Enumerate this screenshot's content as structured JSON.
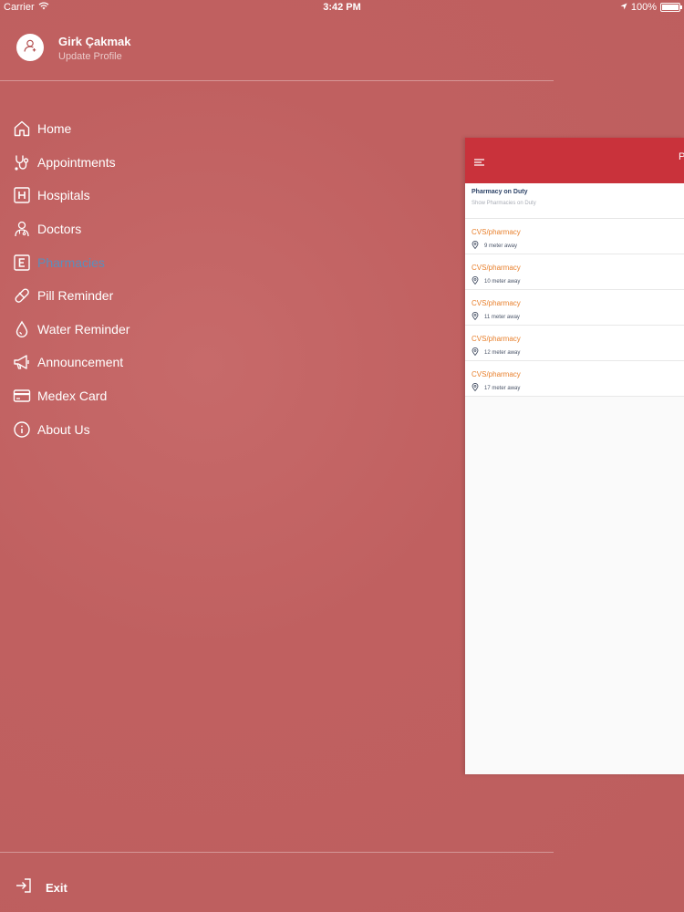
{
  "status_bar": {
    "carrier": "Carrier",
    "time": "3:42 PM",
    "battery": "100%"
  },
  "profile": {
    "name": "Girk  Çakmak",
    "subtitle": "Update Profile"
  },
  "menu": {
    "items": [
      {
        "label": "Home",
        "icon": "home-icon"
      },
      {
        "label": "Appointments",
        "icon": "stethoscope-icon"
      },
      {
        "label": "Hospitals",
        "icon": "hospital-icon"
      },
      {
        "label": "Doctors",
        "icon": "doctor-icon"
      },
      {
        "label": "Pharmacies",
        "icon": "pharmacy-icon",
        "active": true
      },
      {
        "label": "Pill Reminder",
        "icon": "pill-icon"
      },
      {
        "label": "Water Reminder",
        "icon": "water-drop-icon"
      },
      {
        "label": "Announcement",
        "icon": "megaphone-icon"
      },
      {
        "label": "Medex Card",
        "icon": "card-icon"
      },
      {
        "label": "About Us",
        "icon": "info-icon"
      }
    ]
  },
  "exit": {
    "label": "Exit"
  },
  "panel": {
    "title_partial": "P",
    "subheader": {
      "title": "Pharmacy on Duty",
      "subtitle": "Show Pharmacies on Duty"
    },
    "pharmacies": [
      {
        "name": "CVS/pharmacy",
        "distance": "9 meter away"
      },
      {
        "name": "CVS/pharmacy",
        "distance": "10 meter away"
      },
      {
        "name": "CVS/pharmacy",
        "distance": "11 meter away"
      },
      {
        "name": "CVS/pharmacy",
        "distance": "12 meter away"
      },
      {
        "name": "CVS/pharmacy",
        "distance": "17 meter away"
      }
    ]
  },
  "colors": {
    "background": "#c26262",
    "header_red": "#c9323b",
    "accent_orange": "#e8812e",
    "active_blue": "#5a8fbd"
  }
}
